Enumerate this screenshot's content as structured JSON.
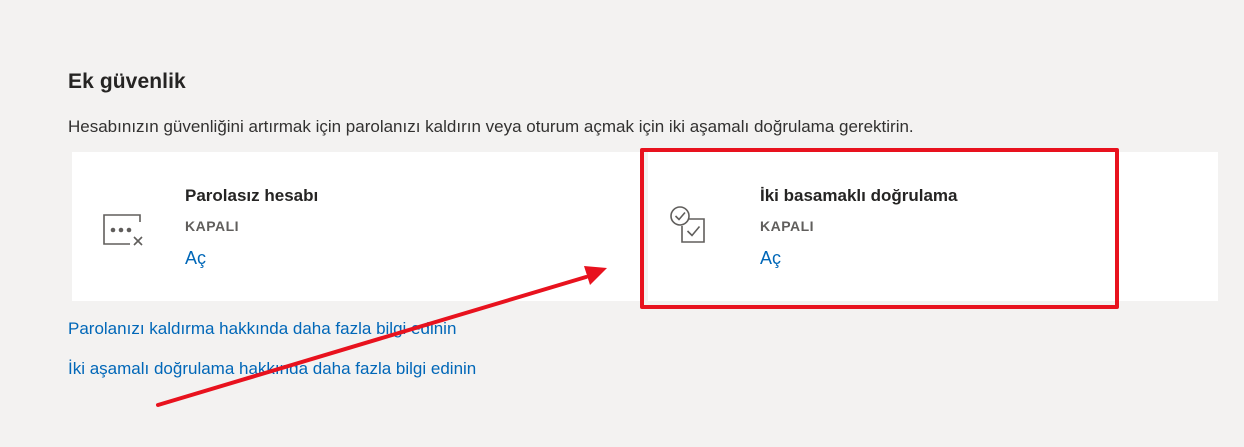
{
  "section": {
    "title": "Ek güvenlik",
    "description": "Hesabınızın güvenliğini artırmak için parolanızı kaldırın veya oturum açmak için iki aşamalı doğrulama gerektirin."
  },
  "cards": [
    {
      "icon": "password-dots-x-icon",
      "title": "Parolasız hesabı",
      "status": "KAPALI",
      "action": "Aç"
    },
    {
      "icon": "two-step-checkmarks-icon",
      "title": "İki basamaklı doğrulama",
      "status": "KAPALI",
      "action": "Aç"
    }
  ],
  "links": {
    "passwordless": "Parolanızı kaldırma hakkında daha fazla bilgi edinin",
    "two_step": "İki aşamalı doğrulama hakkında daha fazla bilgi edinin"
  },
  "annotation": {
    "color": "#e8121e"
  }
}
